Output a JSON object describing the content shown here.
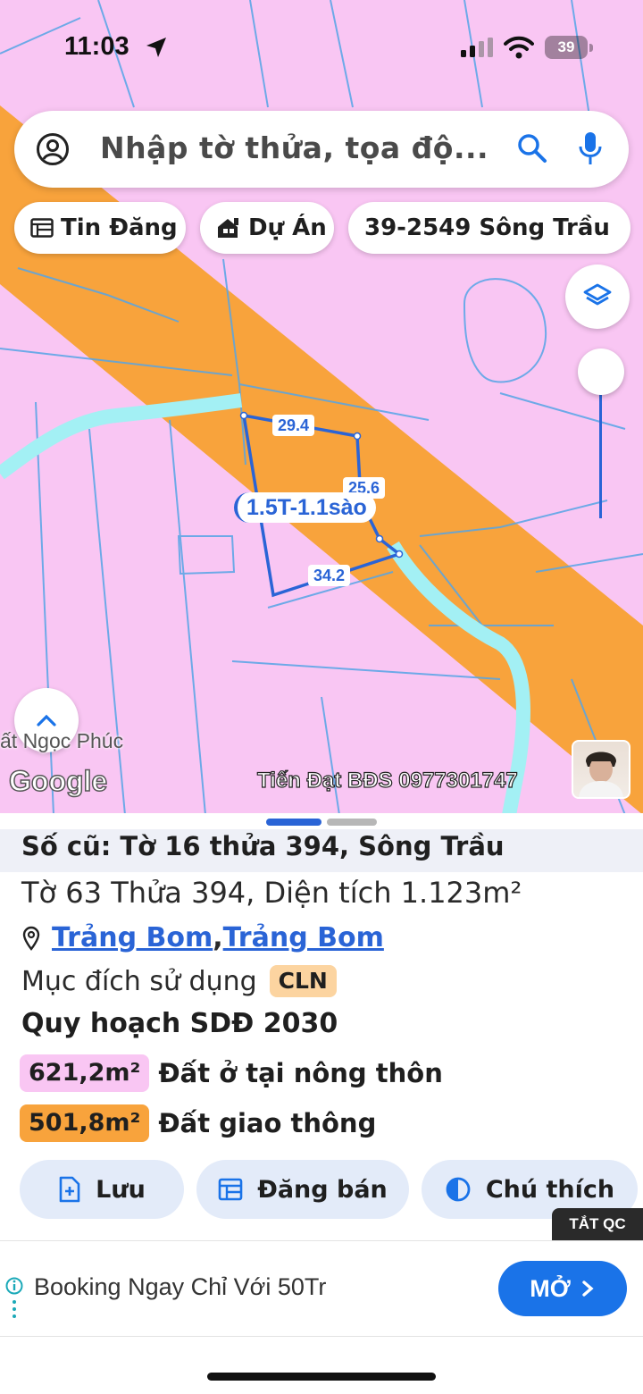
{
  "status_bar": {
    "time": "11:03",
    "battery": "39"
  },
  "search": {
    "placeholder": "Nhập tờ thửa, tọa độ..."
  },
  "chips": [
    {
      "label": "Tin Đăng",
      "icon": "listing-icon"
    },
    {
      "label": "Dự Án",
      "icon": "project-icon"
    },
    {
      "label": "39-2549 Sông Trầu",
      "icon": ""
    }
  ],
  "map": {
    "segment_labels": [
      "29.4",
      "25.6",
      "34.2"
    ],
    "parcel_label": "1.5T-1.1sào",
    "place_label": "ất Ngọc Phúc",
    "attribution": "Google",
    "owner_watermark": "Tiến Đạt BĐS 0977301747",
    "colors": {
      "residential": "#f9c6f3",
      "road": "#f8a33c",
      "water": "#a3f0f4",
      "boundary": "#2a64d6"
    }
  },
  "sheet": {
    "old_parcel": "Số cũ: Tờ 16 thửa 394, Sông Trầu",
    "parcel_info": "Tờ 63 Thửa 394, Diện tích 1.123m²",
    "address": {
      "ward": "Trảng Bom",
      "district": "Trảng Bom",
      "separator": ", "
    },
    "land_use_label": "Mục đích sử dụng",
    "land_use_code": "CLN",
    "plan_title": "Quy hoạch SDĐ 2030",
    "zones": [
      {
        "area": "621,2m²",
        "name": "Đất ở tại nông thôn",
        "color": "#f9c6f3"
      },
      {
        "area": "501,8m²",
        "name": "Đất giao thông",
        "color": "#f8a33c"
      }
    ],
    "actions": {
      "save": "Lưu",
      "post": "Đăng bán",
      "legend": "Chú thích"
    }
  },
  "ad": {
    "close_tag": "TẮT QC",
    "text": "Booking Ngay Chỉ Với 50Tr",
    "button": "MỞ"
  }
}
